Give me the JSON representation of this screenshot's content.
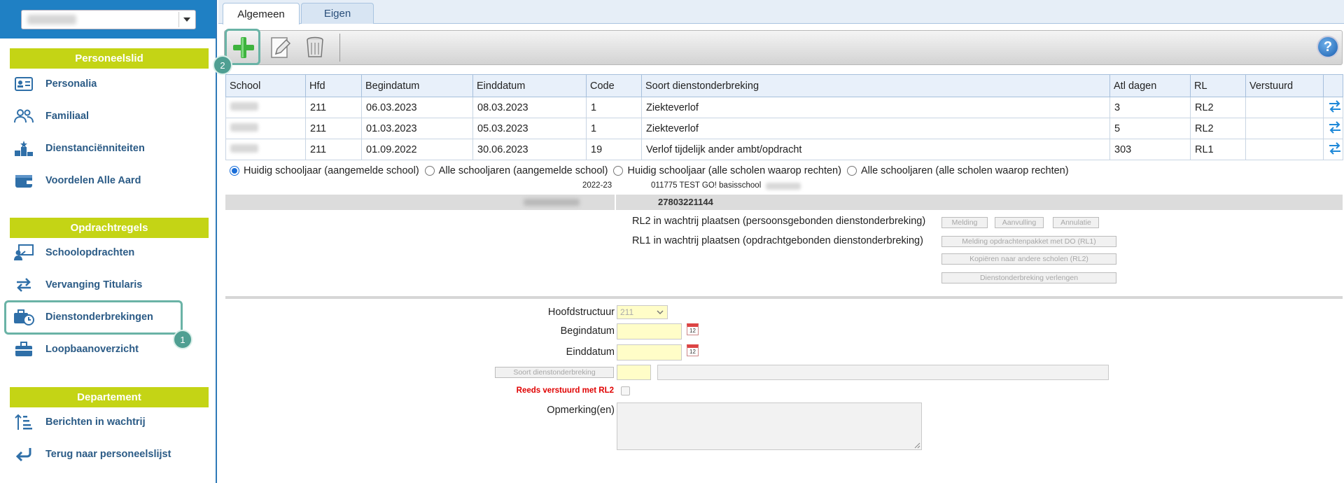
{
  "sidebar": {
    "section_personeel": "Personeelslid",
    "section_opdracht": "Opdrachtregels",
    "section_departement": "Departement",
    "items_personeel": [
      {
        "label": "Personalia",
        "icon": "id-card-icon"
      },
      {
        "label": "Familiaal",
        "icon": "users-icon"
      },
      {
        "label": "Dienstanciënniteiten",
        "icon": "podium-icon"
      },
      {
        "label": "Voordelen Alle Aard",
        "icon": "wallet-icon"
      }
    ],
    "items_opdracht": [
      {
        "label": "Schoolopdrachten",
        "icon": "teacher-board-icon"
      },
      {
        "label": "Vervanging Titularis",
        "icon": "swap-arrows-icon"
      },
      {
        "label": "Dienstonderbrekingen",
        "icon": "briefcase-clock-icon"
      },
      {
        "label": "Loopbaanoverzicht",
        "icon": "briefcase-icon"
      }
    ],
    "items_departement": [
      {
        "label": "Berichten in wachtrij",
        "icon": "sort-list-icon"
      },
      {
        "label": "Terug naar personeelslijst",
        "icon": "return-arrow-icon"
      }
    ]
  },
  "annotations": {
    "badge_1": "1",
    "badge_2": "2"
  },
  "tabs": [
    {
      "label": "Algemeen",
      "active": true
    },
    {
      "label": "Eigen",
      "active": false
    }
  ],
  "toolbar": {
    "help": "?"
  },
  "table": {
    "headers": [
      "School",
      "Hfd",
      "Begindatum",
      "Einddatum",
      "Code",
      "Soort dienstonderbreking",
      "Atl dagen",
      "RL",
      "Verstuurd",
      ""
    ],
    "rows": [
      {
        "hfd": "211",
        "begin": "06.03.2023",
        "eind": "08.03.2023",
        "code": "1",
        "soort": "Ziekteverlof",
        "atl": "3",
        "rl": "RL2",
        "verstuurd": ""
      },
      {
        "hfd": "211",
        "begin": "01.03.2023",
        "eind": "05.03.2023",
        "code": "1",
        "soort": "Ziekteverlof",
        "atl": "5",
        "rl": "RL2",
        "verstuurd": ""
      },
      {
        "hfd": "211",
        "begin": "01.09.2022",
        "eind": "30.06.2023",
        "code": "19",
        "soort": "Verlof tijdelijk ander ambt/opdracht",
        "atl": "303",
        "rl": "RL1",
        "verstuurd": ""
      }
    ]
  },
  "filters": [
    {
      "label": "Huidig schooljaar (aangemelde school)",
      "selected": true
    },
    {
      "label": "Alle schooljaren (aangemelde school)",
      "selected": false
    },
    {
      "label": "Huidig schooljaar (alle scholen waarop rechten)",
      "selected": false
    },
    {
      "label": "Alle schooljaren (alle scholen waarop rechten)",
      "selected": false
    }
  ],
  "info": {
    "schooljaar": "2022-23",
    "school": "011775 TEST GO! basisschool",
    "number": "27803221144"
  },
  "queue": {
    "rl2_label": "RL2 in wachtrij plaatsen (persoonsgebonden dienstonderbreking)",
    "rl1_label": "RL1 in wachtrij plaatsen (opdrachtgebonden dienstonderbreking)",
    "btn_melding": "Melding",
    "btn_aanvulling": "Aanvulling",
    "btn_annulatie": "Annulatie",
    "btn_melding_pakket": "Melding opdrachtenpakket met DO (RL1)",
    "btn_kopieren": "Kopiëren naar andere scholen (RL2)",
    "btn_verlengen": "Dienstonderbreking verlengen"
  },
  "form": {
    "hoofdstructuur_label": "Hoofdstructuur",
    "hoofdstructuur_value": "211",
    "begindatum_label": "Begindatum",
    "einddatum_label": "Einddatum",
    "soort_button": "Soort dienstonderbreking",
    "reeds_label": "Reeds verstuurd met RL2",
    "opmerking_label": "Opmerking(en)",
    "calendar_text": "12"
  },
  "colors": {
    "sidebar_header": "#1f80c4",
    "section_head": "#c4d415",
    "nav_text": "#2b5b86",
    "highlight": "#6ab3a6",
    "warning_text": "#e00000",
    "input_yellow": "#fffdc8"
  }
}
